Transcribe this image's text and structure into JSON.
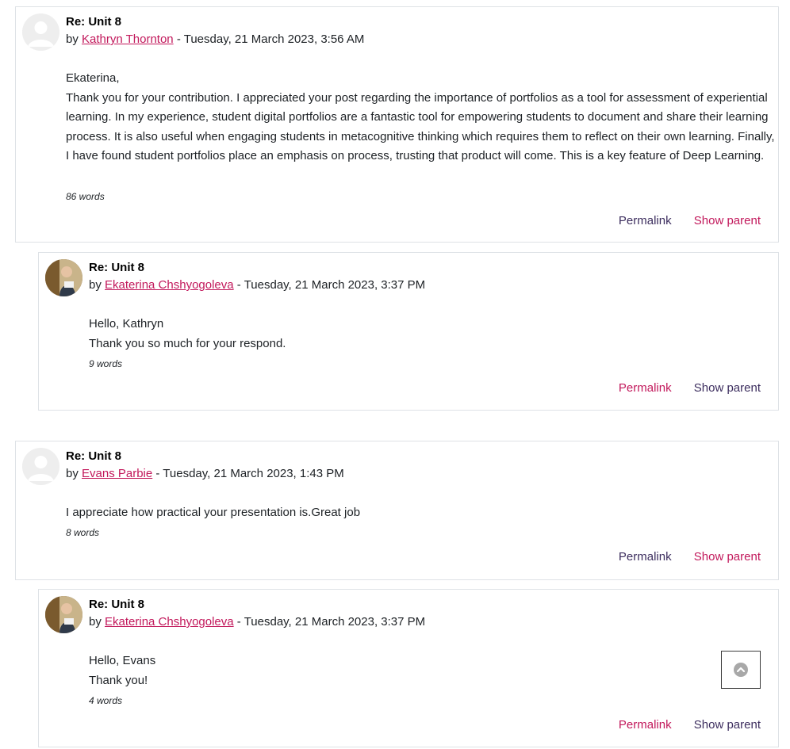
{
  "posts": [
    {
      "title": "Re: Unit 8",
      "by": "by",
      "author": "Kathryn Thornton",
      "date": "- Tuesday, 21 March 2023, 3:56 AM",
      "paragraphs": [
        "Ekaterina,",
        "Thank you for your contribution. I appreciated your post regarding the importance of portfolios as a tool for assessment of experiential learning. In my experience, student digital portfolios are a fantastic tool for empowering students to document and share their learning process. It is also useful when engaging students in metacognitive thinking which requires them to reflect on their own learning. Finally, I have found student portfolios place an emphasis on process, trusting that product will come. This is a key feature of Deep Learning."
      ],
      "word_count": "86 words",
      "permalink": "Permalink",
      "show_parent": "Show parent"
    },
    {
      "title": "Re: Unit 8",
      "by": "by",
      "author": "Ekaterina Chshyogoleva",
      "date": "- Tuesday, 21 March 2023, 3:37 PM",
      "paragraphs": [
        "Hello, Kathryn",
        "Thank you so much for your respond."
      ],
      "word_count": "9 words",
      "permalink": "Permalink",
      "show_parent": "Show parent"
    },
    {
      "title": "Re: Unit 8",
      "by": "by",
      "author": "Evans Parbie",
      "date": "- Tuesday, 21 March 2023, 1:43 PM",
      "paragraphs": [
        "I appreciate how practical your presentation is.Great job"
      ],
      "word_count": "8 words",
      "permalink": "Permalink",
      "show_parent": "Show parent"
    },
    {
      "title": "Re: Unit 8",
      "by": "by",
      "author": "Ekaterina Chshyogoleva",
      "date": "- Tuesday, 21 March 2023, 3:37 PM",
      "paragraphs": [
        "Hello, Evans",
        "Thank you!"
      ],
      "word_count": "4 words",
      "permalink": "Permalink",
      "show_parent": "Show parent"
    }
  ],
  "colors": {
    "link_pink": "#c2185b",
    "link_dark": "#3c2d5e",
    "border": "#dee2e6"
  },
  "icons": {
    "scroll_top": "chevron-up-circle-icon"
  }
}
